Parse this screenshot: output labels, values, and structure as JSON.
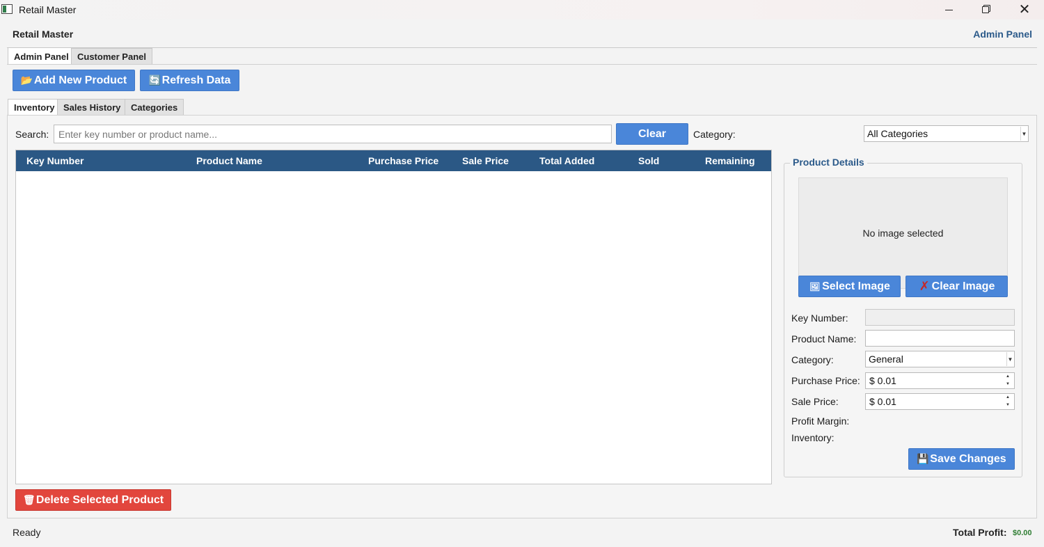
{
  "window": {
    "title": "Retail Master"
  },
  "header": {
    "title": "Retail Master",
    "panel_label": "Admin Panel"
  },
  "top_tabs": [
    {
      "label": "Admin Panel",
      "active": true
    },
    {
      "label": "Customer Panel",
      "active": false
    }
  ],
  "toolbar": {
    "add_label": "Add New Product",
    "refresh_label": "Refresh Data"
  },
  "sub_tabs": [
    {
      "label": "Inventory",
      "active": true
    },
    {
      "label": "Sales History",
      "active": false
    },
    {
      "label": "Categories",
      "active": false
    }
  ],
  "search": {
    "label": "Search:",
    "placeholder": "Enter key number or product name...",
    "value": "",
    "clear_label": "Clear",
    "category_label": "Category:",
    "category_value": "All Categories"
  },
  "table": {
    "columns": [
      "Key Number",
      "Product Name",
      "Purchase Price",
      "Sale Price",
      "Total Added",
      "Sold",
      "Remaining"
    ],
    "rows": []
  },
  "details": {
    "title": "Product Details",
    "no_image": "No image selected",
    "select_image_label": "Select Image",
    "clear_image_label": "Clear Image",
    "key_number_label": "Key Number:",
    "key_number_value": "",
    "product_name_label": "Product Name:",
    "product_name_value": "",
    "category_label": "Category:",
    "category_value": "General",
    "purchase_price_label": "Purchase Price:",
    "purchase_price_value": "$ 0.01",
    "sale_price_label": "Sale Price:",
    "sale_price_value": "$ 0.01",
    "profit_margin_label": "Profit Margin:",
    "inventory_label": "Inventory:",
    "save_label": "Save Changes"
  },
  "actions": {
    "delete_label": "Delete Selected Product"
  },
  "statusbar": {
    "status": "Ready",
    "profit_label": "Total Profit:",
    "profit_value": "$0.00"
  },
  "colors": {
    "button_blue": "#4a86d9",
    "button_red": "#e2463d",
    "table_header": "#2b5885",
    "accent_text": "#2b5a8a",
    "profit_green": "#2e7d32"
  }
}
